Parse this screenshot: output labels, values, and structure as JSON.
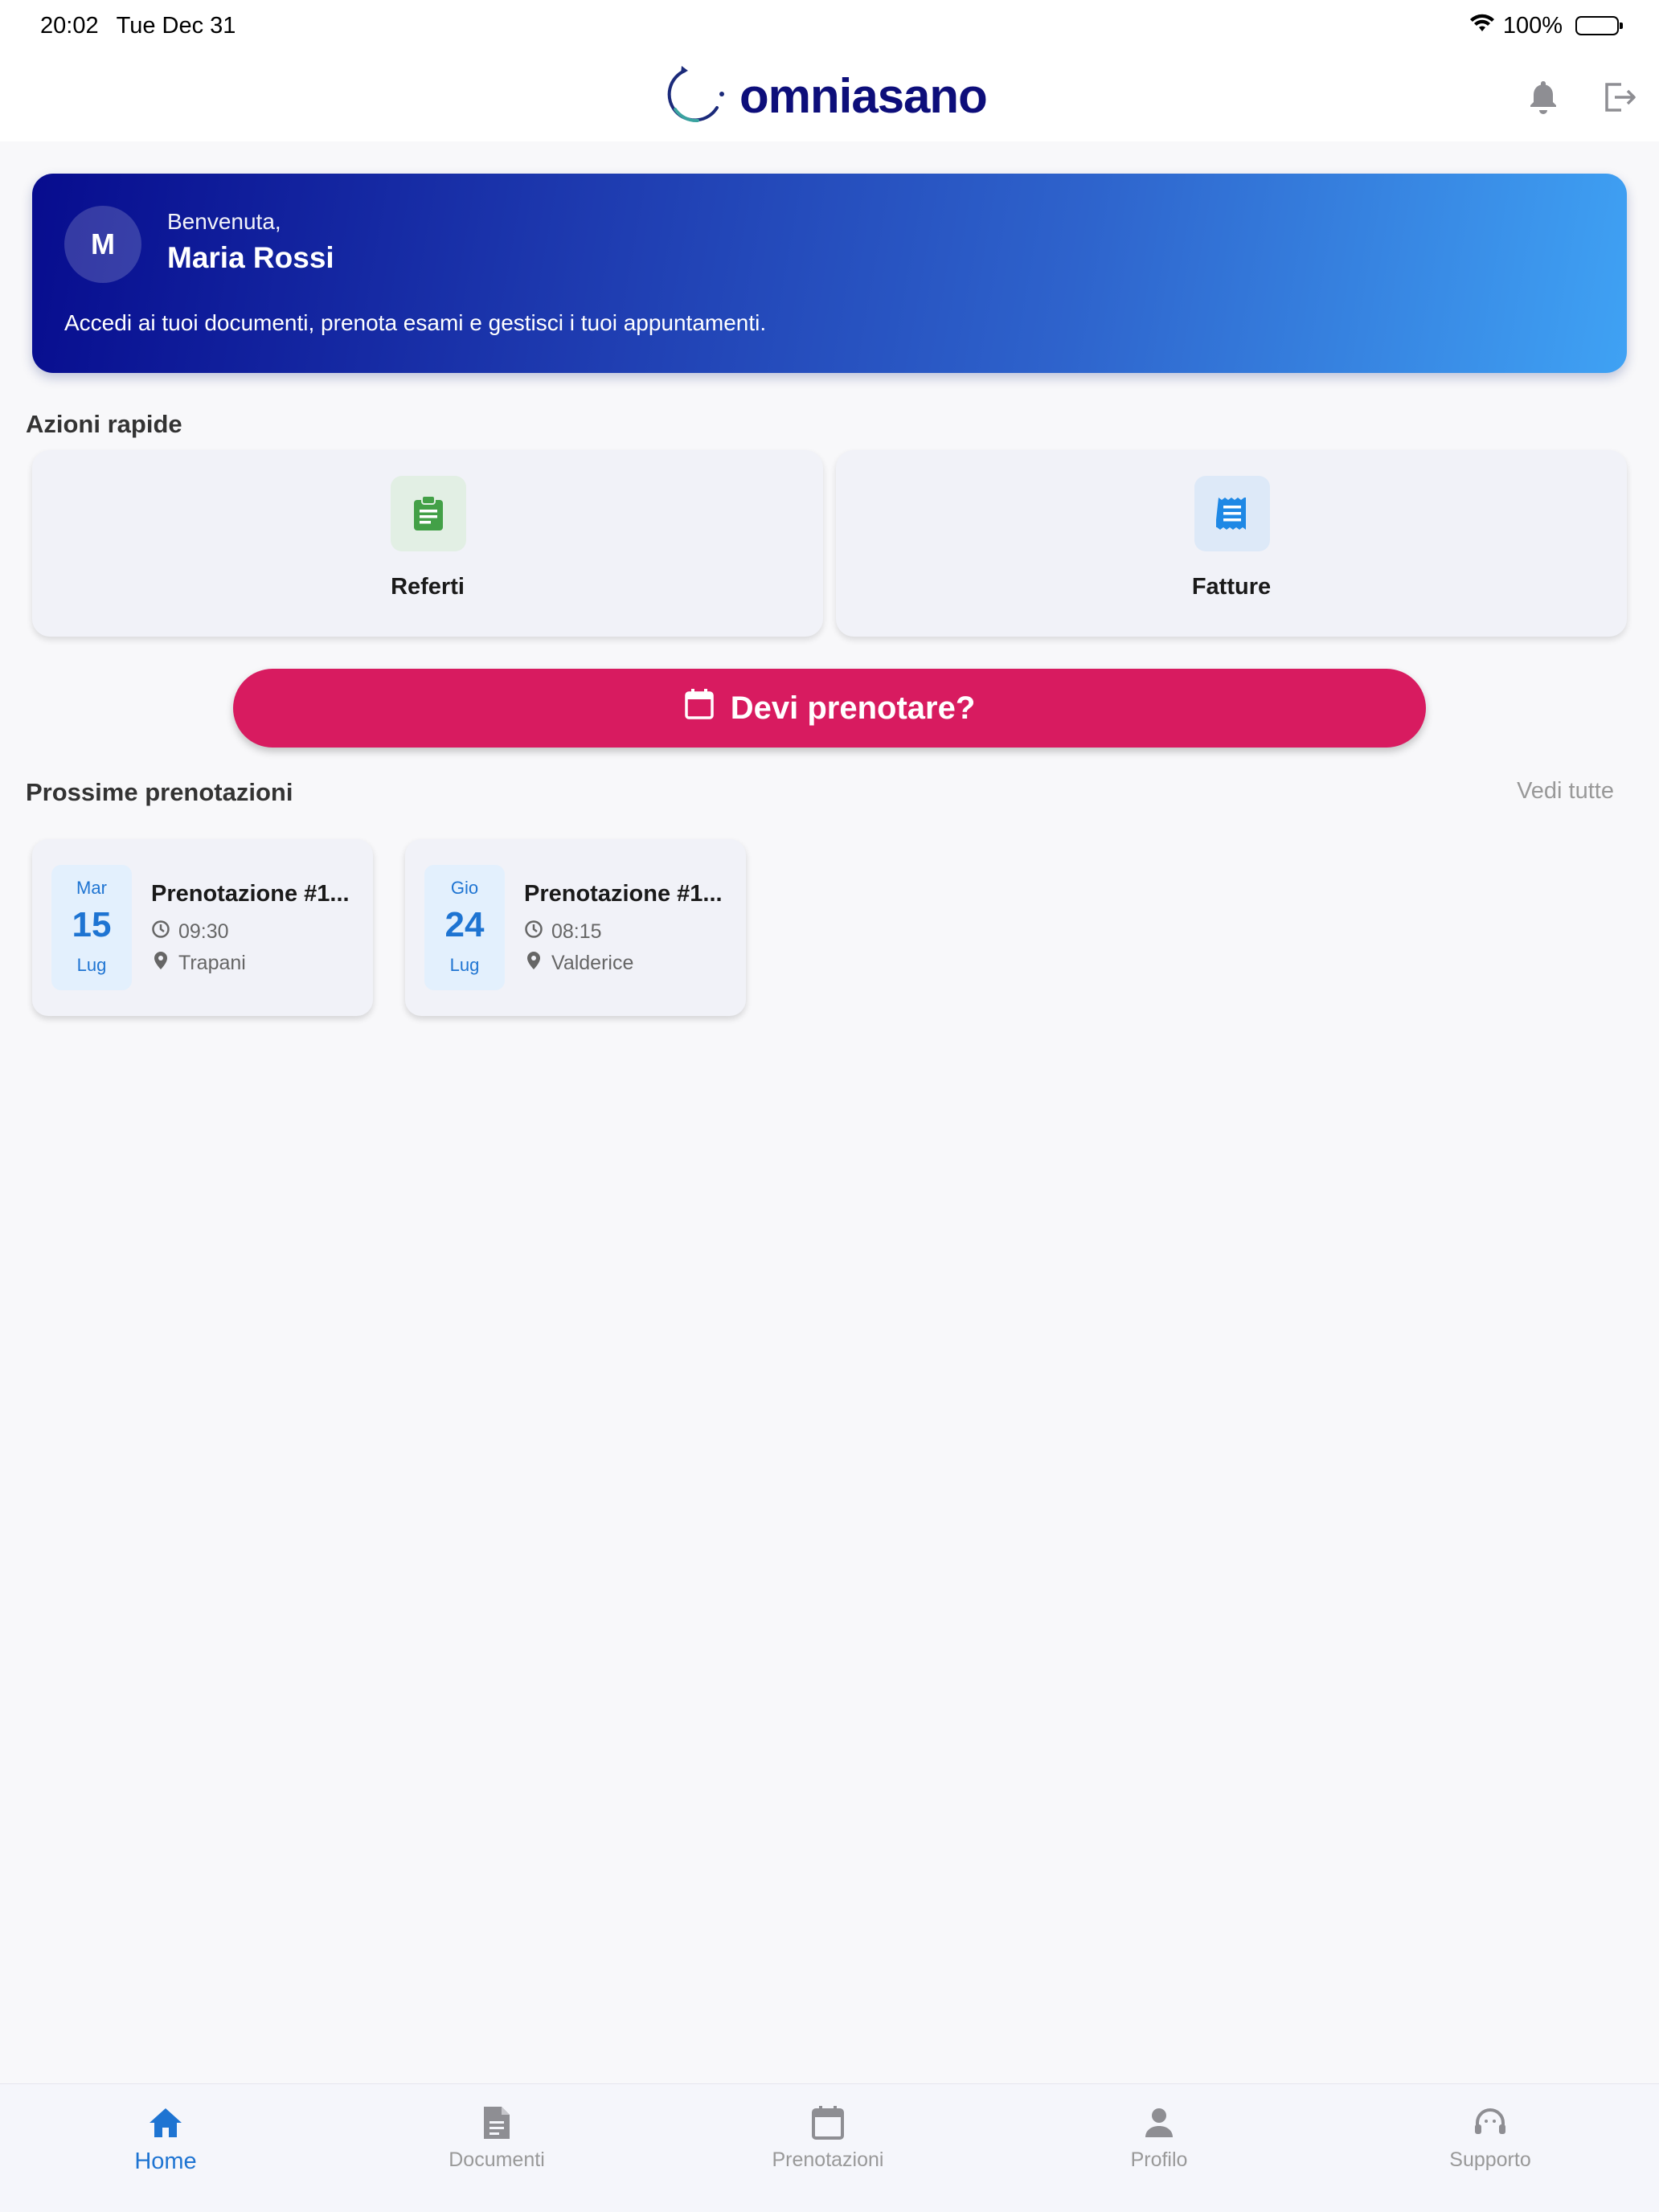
{
  "status_bar": {
    "time": "20:02",
    "date": "Tue Dec 31",
    "battery": "100%"
  },
  "header": {
    "logo_text": "omniasano",
    "icons": [
      "bell-icon",
      "logout-icon"
    ]
  },
  "welcome": {
    "avatar_initial": "M",
    "greeting": "Benvenuta,",
    "name": "Maria Rossi",
    "description": "Accedi ai tuoi documenti, prenota esami e gestisci i tuoi appuntamenti."
  },
  "quick_actions": {
    "title": "Azioni rapide",
    "items": [
      {
        "label": "Referti",
        "icon": "clipboard-icon",
        "color": "#43a047"
      },
      {
        "label": "Fatture",
        "icon": "receipt-icon",
        "color": "#1e88e5"
      }
    ]
  },
  "book_button": {
    "label": "Devi prenotare?",
    "icon": "calendar-icon",
    "color": "#d81b60"
  },
  "upcoming": {
    "title": "Prossime prenotazioni",
    "see_all": "Vedi tutte",
    "bookings": [
      {
        "dow": "Mar",
        "day": "15",
        "month": "Lug",
        "title": "Prenotazione #1...",
        "time": "09:30",
        "location": "Trapani"
      },
      {
        "dow": "Gio",
        "day": "24",
        "month": "Lug",
        "title": "Prenotazione #1...",
        "time": "08:15",
        "location": "Valderice"
      }
    ]
  },
  "bottom_nav": {
    "items": [
      {
        "label": "Home",
        "icon": "home-icon",
        "active": true
      },
      {
        "label": "Documenti",
        "icon": "document-icon",
        "active": false
      },
      {
        "label": "Prenotazioni",
        "icon": "calendar-icon",
        "active": false
      },
      {
        "label": "Profilo",
        "icon": "person-icon",
        "active": false
      },
      {
        "label": "Supporto",
        "icon": "support-icon",
        "active": false
      }
    ],
    "active_color": "#1e74d2"
  }
}
